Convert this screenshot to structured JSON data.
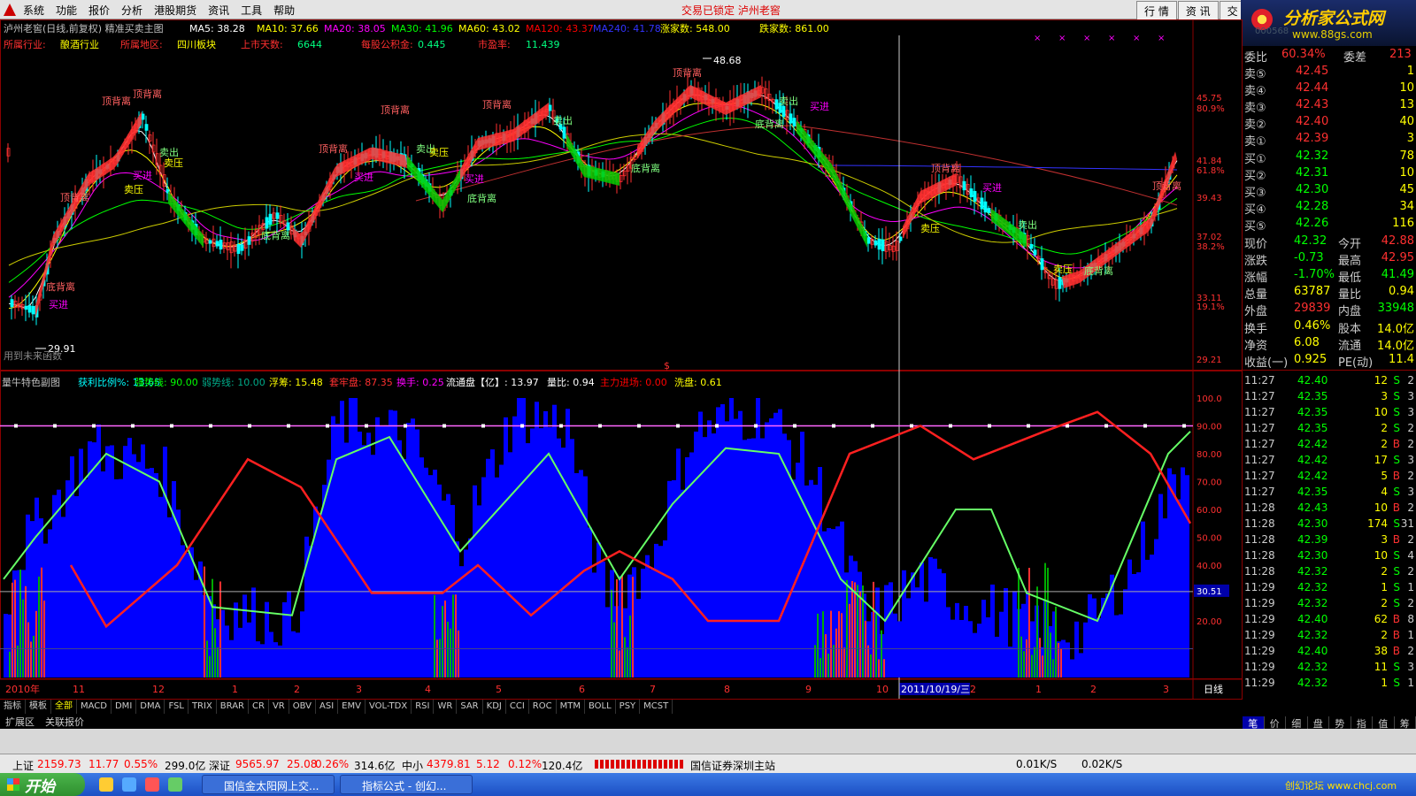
{
  "menubar": {
    "items": [
      "系统",
      "功能",
      "报价",
      "分析",
      "港股期货",
      "资讯",
      "工具",
      "帮助"
    ],
    "lock_title": "交易已锁定 泸州老窖",
    "tabs": [
      "行 情",
      "资 讯",
      "交"
    ]
  },
  "brand": {
    "name": "分析家公式网",
    "url": "www.88gs.com",
    "code": "000568"
  },
  "main_header": {
    "line1": [
      {
        "text": "泸州老窖(日线,前复权) 精准买卖主图",
        "color": "#c0c0c0"
      },
      {
        "text": "MA5: 38.28",
        "color": "#ffffff"
      },
      {
        "text": "MA10: 37.66",
        "color": "#ffff00"
      },
      {
        "text": "MA20: 38.05",
        "color": "#ff00ff"
      },
      {
        "text": "MA30: 41.96",
        "color": "#00ff00"
      },
      {
        "text": "MA60: 43.02",
        "color": "#ffff00"
      },
      {
        "text": "MA120: 43.37",
        "color": "#ff0000"
      },
      {
        "text": "MA240: 41.78",
        "color": "#3333ff"
      },
      {
        "text": "涨家数: 548.00",
        "color": "#ffff00"
      },
      {
        "text": "跌家数: 861.00",
        "color": "#ffff00"
      }
    ],
    "line2": [
      {
        "label": "所属行业:",
        "value": "酿酒行业"
      },
      {
        "label": "所属地区:",
        "value": "四川板块"
      },
      {
        "label": "上市天数:",
        "value": "6644"
      },
      {
        "label": "每股公积金:",
        "value": "0.445"
      },
      {
        "label": "市盈率:",
        "value": "11.439"
      }
    ]
  },
  "main_axis": {
    "prices": [
      "45.75",
      "41.84",
      "39.43",
      "37.02",
      "33.11",
      "29.21"
    ],
    "percents": [
      "80.9%",
      "61.8%",
      "38.2%",
      "19.1%"
    ]
  },
  "annotations": {
    "high_label": "48.68",
    "low_label": "29.91",
    "watermark": "用到未来函数",
    "sell_label": "顶背离",
    "buy_label": "底背离",
    "buy_in": "买进",
    "sell_out": "卖出",
    "pressure": "卖压",
    "cursor_mark": "$"
  },
  "sub_header": [
    {
      "text": "量牛特色副图",
      "color": "#c0c0c0"
    },
    {
      "text": "获利比例%: 13.65",
      "color": "#00ffff"
    },
    {
      "text": "强势线: 90.00",
      "color": "#00ff00"
    },
    {
      "text": "弱势线: 10.00",
      "color": "#00aa88"
    },
    {
      "text": "浮筹: 15.48",
      "color": "#ffff00"
    },
    {
      "text": "套牢盘: 87.35",
      "color": "#ff3030"
    },
    {
      "text": "换手: 0.25",
      "color": "#ff00ff"
    },
    {
      "text": "流通盘【亿】: 13.97",
      "color": "#ffffff"
    },
    {
      "text": "量比: 0.94",
      "color": "#ffffff"
    },
    {
      "text": "主力进场: 0.00",
      "color": "#ff0000"
    },
    {
      "text": "洗盘: 0.61",
      "color": "#ffff00"
    }
  ],
  "sub_axis": [
    "100.0",
    "90.00",
    "80.00",
    "70.00",
    "60.00",
    "50.00",
    "40.00",
    "30.00",
    "20.00"
  ],
  "sub_axis_current": "30.51",
  "time_axis": {
    "labels": [
      "2010年",
      "11",
      "12",
      "1",
      "2",
      "3",
      "4",
      "5",
      "6",
      "7",
      "8",
      "9",
      "10",
      "2",
      "1",
      "2",
      "3"
    ],
    "cursor_date": "2011/10/19/三",
    "period": "日线",
    "zoom_controls": [
      "+",
      "-",
      "0"
    ]
  },
  "indicator_tabs": [
    "指标",
    "模板",
    "全部",
    "MACD",
    "DMI",
    "DMA",
    "FSL",
    "TRIX",
    "BRAR",
    "CR",
    "VR",
    "OBV",
    "ASI",
    "EMV",
    "VOL-TDX",
    "RSI",
    "WR",
    "SAR",
    "KDJ",
    "CCI",
    "ROC",
    "MTM",
    "BOLL",
    "PSY",
    "MCST"
  ],
  "ext_tabs": [
    "扩展区",
    "关联报价"
  ],
  "quote": {
    "weibi": {
      "label": "委比",
      "value": "60.34%",
      "label2": "委差",
      "value2": "213"
    },
    "asks": [
      {
        "label": "卖⑤",
        "price": "42.45",
        "vol": "1"
      },
      {
        "label": "卖④",
        "price": "42.44",
        "vol": "10"
      },
      {
        "label": "卖③",
        "price": "42.43",
        "vol": "13"
      },
      {
        "label": "卖②",
        "price": "42.40",
        "vol": "40"
      },
      {
        "label": "卖①",
        "price": "42.39",
        "vol": "3"
      }
    ],
    "bids": [
      {
        "label": "买①",
        "price": "42.32",
        "vol": "78"
      },
      {
        "label": "买②",
        "price": "42.31",
        "vol": "10"
      },
      {
        "label": "买③",
        "price": "42.30",
        "vol": "45"
      },
      {
        "label": "买④",
        "price": "42.28",
        "vol": "34"
      },
      {
        "label": "买⑤",
        "price": "42.26",
        "vol": "116"
      }
    ],
    "stats": [
      {
        "l1": "现价",
        "v1": "42.32",
        "c1": "#00ff00",
        "l2": "今开",
        "v2": "42.88",
        "c2": "#ff3030"
      },
      {
        "l1": "涨跌",
        "v1": "-0.73",
        "c1": "#00ff00",
        "l2": "最高",
        "v2": "42.95",
        "c2": "#ff3030"
      },
      {
        "l1": "涨幅",
        "v1": "-1.70%",
        "c1": "#00ff00",
        "l2": "最低",
        "v2": "41.49",
        "c2": "#00ff00"
      },
      {
        "l1": "总量",
        "v1": "63787",
        "c1": "#ffff00",
        "l2": "量比",
        "v2": "0.94",
        "c2": "#ffff00"
      },
      {
        "l1": "外盘",
        "v1": "29839",
        "c1": "#ff3030",
        "l2": "内盘",
        "v2": "33948",
        "c2": "#00ff00"
      }
    ],
    "stats2": [
      {
        "l1": "换手",
        "v1": "0.46%",
        "l2": "股本",
        "v2": "14.0亿"
      },
      {
        "l1": "净资",
        "v1": "6.08",
        "l2": "流通",
        "v2": "14.0亿"
      },
      {
        "l1": "收益(一)",
        "v1": "0.925",
        "l2": "PE(动)",
        "v2": "11.4"
      }
    ]
  },
  "ticks": [
    {
      "t": "11:27",
      "p": "42.40",
      "v": "12",
      "d": "S",
      "n": "2"
    },
    {
      "t": "11:27",
      "p": "42.35",
      "v": "3",
      "d": "S",
      "n": "3"
    },
    {
      "t": "11:27",
      "p": "42.35",
      "v": "10",
      "d": "S",
      "n": "3"
    },
    {
      "t": "11:27",
      "p": "42.35",
      "v": "2",
      "d": "S",
      "n": "2"
    },
    {
      "t": "11:27",
      "p": "42.42",
      "v": "2",
      "d": "B",
      "n": "2"
    },
    {
      "t": "11:27",
      "p": "42.42",
      "v": "17",
      "d": "S",
      "n": "3"
    },
    {
      "t": "11:27",
      "p": "42.42",
      "v": "5",
      "d": "B",
      "n": "2"
    },
    {
      "t": "11:27",
      "p": "42.35",
      "v": "4",
      "d": "S",
      "n": "3"
    },
    {
      "t": "11:28",
      "p": "42.43",
      "v": "10",
      "d": "B",
      "n": "2"
    },
    {
      "t": "11:28",
      "p": "42.30",
      "v": "174",
      "d": "S",
      "n": "31"
    },
    {
      "t": "11:28",
      "p": "42.39",
      "v": "3",
      "d": "B",
      "n": "2"
    },
    {
      "t": "11:28",
      "p": "42.30",
      "v": "10",
      "d": "S",
      "n": "4"
    },
    {
      "t": "11:28",
      "p": "42.32",
      "v": "2",
      "d": "S",
      "n": "2"
    },
    {
      "t": "11:29",
      "p": "42.32",
      "v": "1",
      "d": "S",
      "n": "1"
    },
    {
      "t": "11:29",
      "p": "42.32",
      "v": "2",
      "d": "S",
      "n": "2"
    },
    {
      "t": "11:29",
      "p": "42.40",
      "v": "62",
      "d": "B",
      "n": "8"
    },
    {
      "t": "11:29",
      "p": "42.32",
      "v": "2",
      "d": "B",
      "n": "1"
    },
    {
      "t": "11:29",
      "p": "42.40",
      "v": "38",
      "d": "B",
      "n": "2"
    },
    {
      "t": "11:29",
      "p": "42.32",
      "v": "11",
      "d": "S",
      "n": "3"
    },
    {
      "t": "11:29",
      "p": "42.32",
      "v": "1",
      "d": "S",
      "n": "1"
    }
  ],
  "right_tabs": [
    "笔",
    "价",
    "细",
    "盘",
    "势",
    "指",
    "值",
    "筹"
  ],
  "statusbar": [
    {
      "text": "上证",
      "color": "#000000"
    },
    {
      "text": "2159.73",
      "color": "#ff0000"
    },
    {
      "text": "11.77",
      "color": "#ff0000"
    },
    {
      "text": "0.55%",
      "color": "#ff0000"
    },
    {
      "text": "299.0亿",
      "color": "#000000"
    },
    {
      "text": "深证",
      "color": "#000000"
    },
    {
      "text": "9565.97",
      "color": "#ff0000"
    },
    {
      "text": "25.08",
      "color": "#ff0000"
    },
    {
      "text": "0.26%",
      "color": "#ff0000"
    },
    {
      "text": "314.6亿",
      "color": "#000000"
    },
    {
      "text": "中小",
      "color": "#000000"
    },
    {
      "text": "4379.81",
      "color": "#ff0000"
    },
    {
      "text": "5.12",
      "color": "#ff0000"
    },
    {
      "text": "0.12%",
      "color": "#ff0000"
    },
    {
      "text": "120.4亿",
      "color": "#000000"
    },
    {
      "text": "国信证券深圳主站",
      "color": "#000000"
    },
    {
      "text": "0.01K/S",
      "color": "#000000"
    },
    {
      "text": "0.02K/S",
      "color": "#000000"
    }
  ],
  "taskbar": {
    "start": "开始",
    "tasks": [
      "国信金太阳网上交...",
      "指标公式 - 创幻..."
    ],
    "tray": "创幻论坛 www.chcj.com"
  }
}
